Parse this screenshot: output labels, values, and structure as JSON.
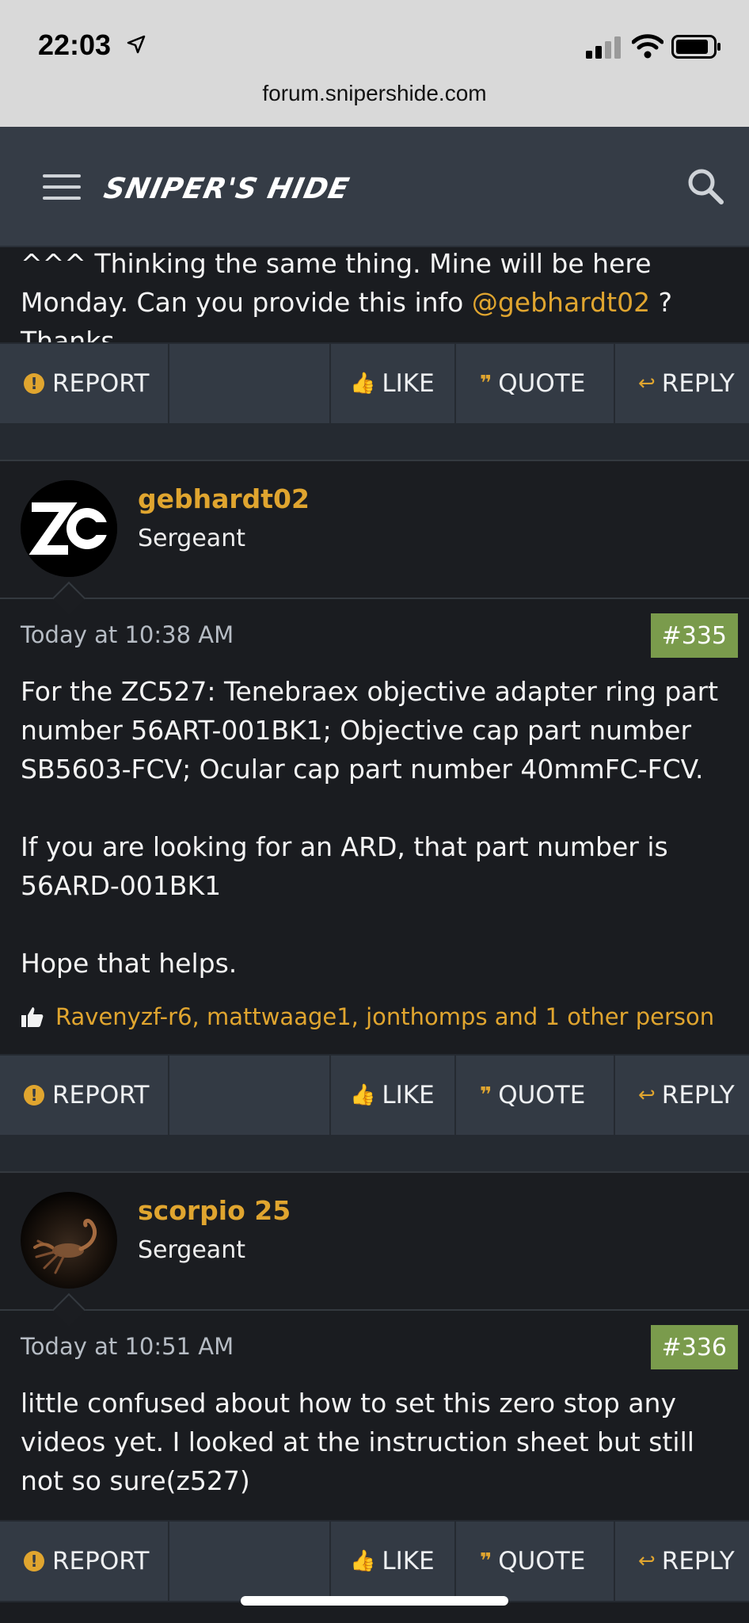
{
  "status": {
    "time": "22:03"
  },
  "browser": {
    "url": "forum.snipershide.com"
  },
  "site": {
    "logo": "SNIPER'S HIDE"
  },
  "prev_post": {
    "text": "^^^ Thinking the same thing. Mine will be here Monday. Can you provide this info ",
    "mention": "@gebhardt02",
    "text_after": " ? Thanks."
  },
  "actions": {
    "report": "REPORT",
    "like": "LIKE",
    "quote": "QUOTE",
    "reply": "REPLY"
  },
  "posts": [
    {
      "username": "gebhardt02",
      "user_title": "Sergeant",
      "date": "Today at 10:38 AM",
      "number": "#335",
      "paragraphs": [
        "For the ZC527: Tenebraex objective adapter ring part number 56ART-001BK1; Objective cap part number SB5603-FCV; Ocular cap part number 40mmFC-FCV.",
        "If you are looking for an ARD, that part number is 56ARD-001BK1",
        "Hope that helps."
      ],
      "likes": "Ravenyzf-r6, mattwaage1, jonthomps and 1 other person"
    },
    {
      "username": "scorpio 25",
      "user_title": "Sergeant",
      "date": "Today at 10:51 AM",
      "number": "#336",
      "paragraphs": [
        "little confused about how to set this zero stop any videos yet. I looked at the instruction sheet but still not so sure(z527)"
      ]
    }
  ],
  "colors": {
    "accent": "#e0a52f",
    "post_number_bg": "#7a9b4c",
    "header_bg": "#353c46",
    "body_bg": "#1a1c20"
  }
}
